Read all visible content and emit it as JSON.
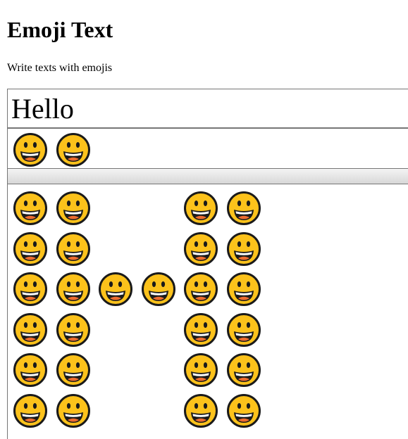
{
  "page": {
    "title": "Emoji Text",
    "subtitle": "Write texts with emojis"
  },
  "input": {
    "value": "Hello"
  },
  "preview": {
    "emoji_icon": "grinning-face-icon",
    "count": 2
  },
  "output": {
    "emoji_icon": "grinning-face-icon",
    "blank_icon": "",
    "grid": [
      [
        1,
        1,
        0,
        0,
        1,
        1
      ],
      [
        1,
        1,
        0,
        0,
        1,
        1
      ],
      [
        1,
        1,
        1,
        1,
        1,
        1
      ],
      [
        1,
        1,
        0,
        0,
        1,
        1
      ],
      [
        1,
        1,
        0,
        0,
        1,
        1
      ],
      [
        1,
        1,
        0,
        0,
        1,
        1
      ]
    ]
  },
  "colors": {
    "emoji_face": "#fcc21b",
    "emoji_outline": "#1a1a1a",
    "emoji_mouth": "#ffffff",
    "emoji_tongue": "#ed6c30"
  }
}
